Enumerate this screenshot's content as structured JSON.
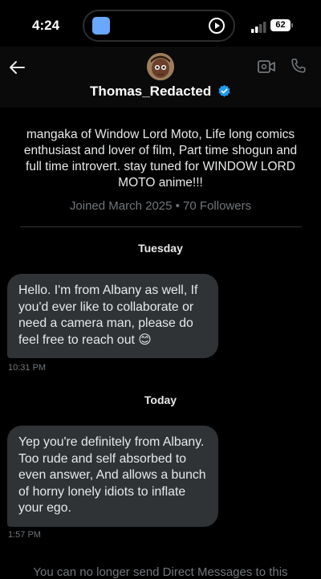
{
  "status_bar": {
    "time": "4:24",
    "battery": "62"
  },
  "header": {
    "username": "Thomas_Redacted",
    "icons": [
      "back-arrow-icon",
      "avatar",
      "verified-badge-icon",
      "video-camera-icon",
      "phone-icon"
    ]
  },
  "profile": {
    "bio": "mangaka of Window Lord Moto, Life long comics enthusiast and lover of film, Part time shogun and full time introvert. stay tuned for WINDOW LORD MOTO anime!!!",
    "joined": "Joined March 2025 • 70 Followers"
  },
  "conversation": {
    "groups": [
      {
        "day": "Tuesday",
        "message": "Hello. I'm from Albany as well, If you'd ever like to collaborate or need a camera man, please do feel free to reach out 😊",
        "time": "10:31 PM"
      },
      {
        "day": "Today",
        "message": "Yep you're definitely from Albany. Too rude and self absorbed to even answer, And allows a bunch of horny lonely idiots to inflate your ego.",
        "time": "1:57 PM"
      }
    ]
  },
  "footer": {
    "notice": "You can no longer send Direct Messages to this"
  },
  "colors": {
    "background": "#000000",
    "bubble": "#2f3336",
    "muted_text": "#71767b",
    "verified": "#1d9bf0"
  }
}
